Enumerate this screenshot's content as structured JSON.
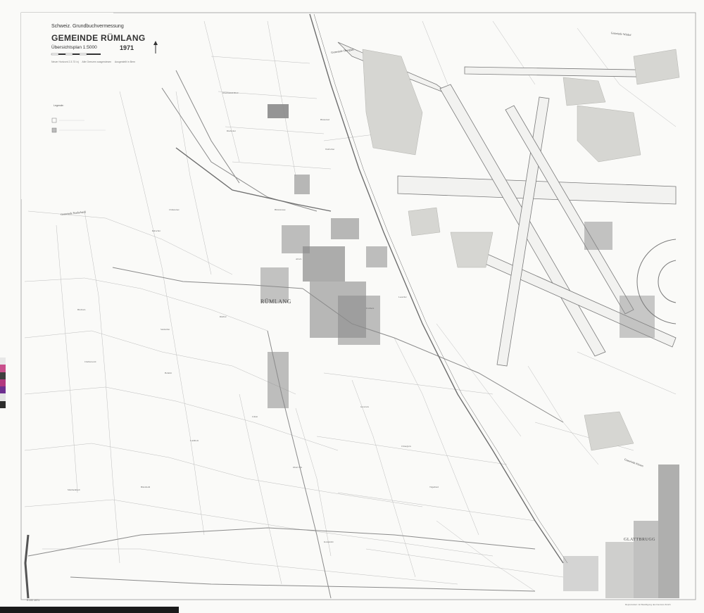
{
  "title_block": {
    "organization": "Schweiz. Grundbuchvermessung",
    "municipality": "GEMEINDE RÜMLANG",
    "plan_type": "Übersichtsplan 1:5000",
    "year": "1971",
    "notes": [
      "Neuer Horizont 2.3.73 /vj",
      "Alte Grenzen ausgewiesen",
      "Ausgestellt in Bern"
    ]
  },
  "legend": {
    "title": "Legende:"
  },
  "places": {
    "village": "RÜMLANG",
    "neighbour_village": "GLATTBRUGG",
    "municipality_north": "Gemeinde Oberglatt",
    "municipality_northeast": "Gemeinde Winkel",
    "municipality_west": "Gemeinde Niederhasli",
    "municipality_east": "Gemeinde Kloten"
  },
  "field_names": [
    "Oberhausen-Ried",
    "Riedacker",
    "Hinterried",
    "Wolfacher",
    "Chrüzacker",
    "Rebacher",
    "Riethof",
    "Altwis",
    "Hürststrasse",
    "Eichholz",
    "Leeacher",
    "Birchwis",
    "Chalberweid",
    "Sandacher",
    "Hohrüti",
    "Laubholz",
    "Lätten",
    "Oberi Wis",
    "Grosswis",
    "Chruegwis",
    "Mettmenhasli",
    "Bärenbohl",
    "Katzenrüti",
    "Tägerhard"
  ],
  "footer": {
    "archive_ref": "R 237 1971",
    "credit": "Reproduziert mit Bewilligung des Kantons Zürich"
  },
  "colors": {
    "paper": "#fafaf8",
    "ink": "#555555",
    "light_line": "#aaaaaa",
    "built_area": "#8a8a8a",
    "frame": "#999999"
  },
  "calibration_strip": [
    "#e8e8e8",
    "#c94f8c",
    "#3e3e3e",
    "#b2387f",
    "#6d2f8f",
    "#e4e4e4",
    "#2c2c2c"
  ]
}
